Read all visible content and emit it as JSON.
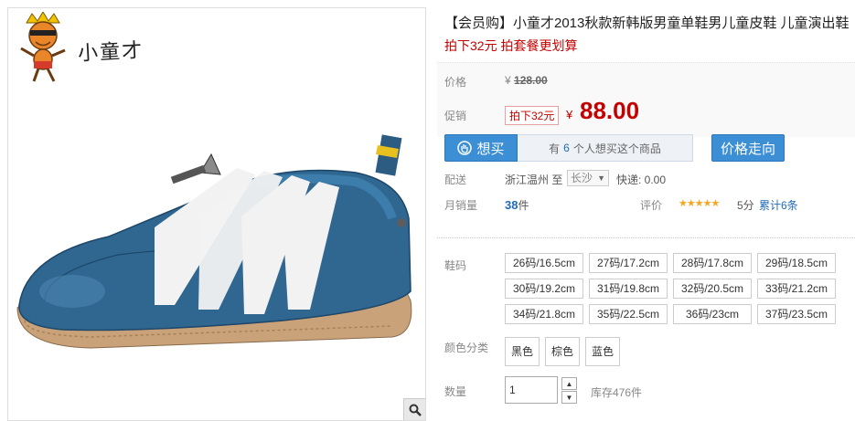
{
  "brand": {
    "name": "小童才"
  },
  "product": {
    "title": "【会员购】小童才2013秋款新韩版男童单鞋男儿童皮鞋 儿童演出鞋",
    "promo_text": "拍下32元 拍套餐更划算"
  },
  "price": {
    "original_label": "价格",
    "currency": "¥",
    "original_value": "128.00",
    "promo_label": "促销",
    "promo_badge": "拍下32元",
    "current_value": "88.00"
  },
  "actions": {
    "want_label": "想买",
    "want_prefix": "有",
    "want_count": "6",
    "want_suffix": "个人想买这个商品",
    "trend_label": "价格走向"
  },
  "shipping": {
    "label": "配送",
    "origin": "浙江温州 至",
    "destination": "长沙",
    "express": "快递: 0.00"
  },
  "sales": {
    "label": "月销量",
    "count": "38",
    "unit": "件",
    "rating_label": "评价",
    "stars": "★★★★★",
    "score": "5分",
    "reviews": "累计6条"
  },
  "sizes": {
    "label": "鞋码",
    "options": [
      "26码/16.5cm",
      "27码/17.2cm",
      "28码/17.8cm",
      "29码/18.5cm",
      "30码/19.2cm",
      "31码/19.8cm",
      "32码/20.5cm",
      "33码/21.2cm",
      "34码/21.8cm",
      "35码/22.5cm",
      "36码/23cm",
      "37码/23.5cm"
    ]
  },
  "colors": {
    "label": "颜色分类",
    "options": [
      "黑色",
      "棕色",
      "蓝色"
    ]
  },
  "quantity": {
    "label": "数量",
    "value": "1",
    "stock": "库存476件"
  },
  "icons": {
    "zoom": "magnifier-icon",
    "want": "hand-icon",
    "mascot": "mascot-logo"
  },
  "colors_theme": {
    "accent_red": "#c40000",
    "button_blue": "#3c8fd4",
    "link_blue": "#1e6bb8",
    "shoe_blue": "#2f6791"
  }
}
